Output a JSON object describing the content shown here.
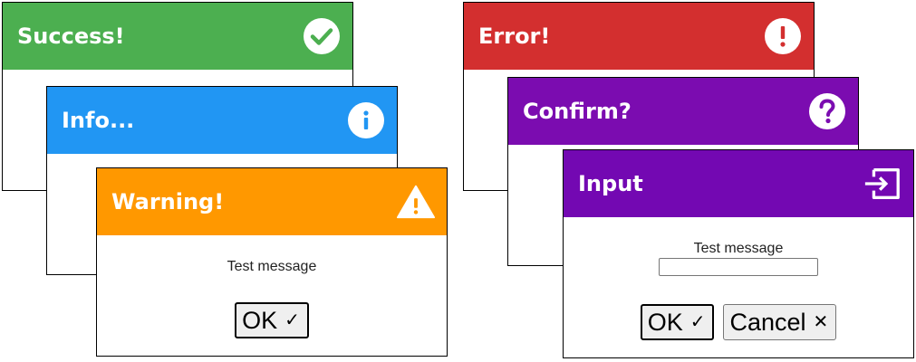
{
  "colors": {
    "success": "#4caf50",
    "info": "#2196f3",
    "warning": "#ff9800",
    "error": "#d32f2f",
    "confirm": "#7b0cb0",
    "input": "#7308b2"
  },
  "dialogs": {
    "success": {
      "title": "Success!",
      "icon": "check-circle-icon"
    },
    "info": {
      "title": "Info...",
      "icon": "info-circle-icon"
    },
    "warning": {
      "title": "Warning!",
      "icon": "warning-triangle-icon",
      "message": "Test message",
      "ok_label": "OK",
      "ok_glyph": "✓"
    },
    "error": {
      "title": "Error!",
      "icon": "exclamation-circle-icon"
    },
    "confirm": {
      "title": "Confirm?",
      "icon": "question-circle-icon"
    },
    "input": {
      "title": "Input",
      "icon": "sign-in-icon",
      "message": "Test message",
      "input_value": "",
      "ok_label": "OK",
      "ok_glyph": "✓",
      "cancel_label": "Cancel",
      "cancel_glyph": "✕"
    }
  }
}
